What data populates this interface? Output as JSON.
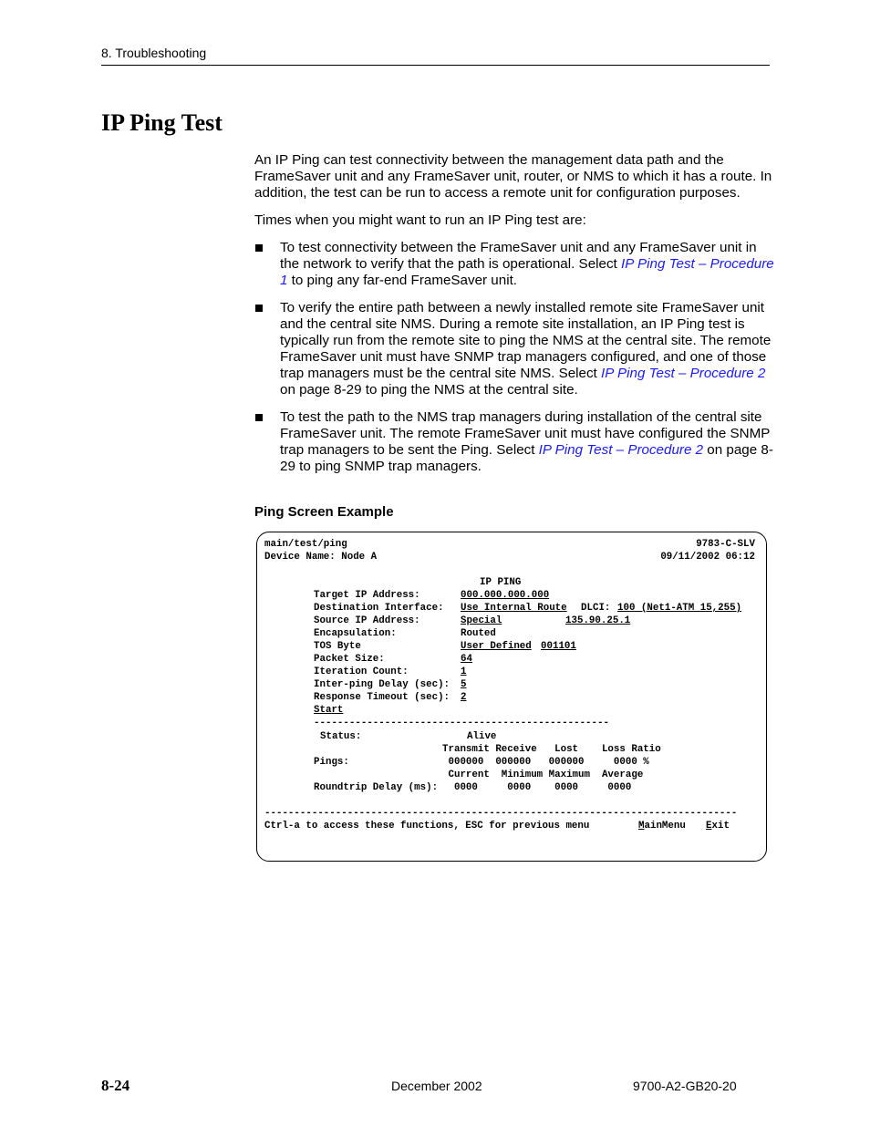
{
  "header": {
    "chapter": "8. Troubleshooting"
  },
  "title": "IP Ping Test",
  "intro": "An IP Ping can test connectivity between the management data path and the FrameSaver unit and any FrameSaver unit, router, or NMS to which it has a route. In addition, the test can be run to access a remote unit for configuration purposes.",
  "lead_in": "Times when you might want to run an IP Ping test are:",
  "bullets": [
    {
      "pre": "To test connectivity between the FrameSaver unit and any FrameSaver unit in the network to verify that the path is operational. Select ",
      "link": "IP Ping Test – Procedure 1",
      "post": " to ping any far-end FrameSaver unit."
    },
    {
      "pre": "To verify the entire path between a newly installed remote site FrameSaver unit and the central site NMS. During a remote site installation, an IP Ping test is typically run from the remote site to ping the NMS at the central site. The remote FrameSaver unit must have SNMP trap managers configured, and one of those trap managers must be the central site NMS. Select ",
      "link": "IP Ping Test – Procedure 2",
      "post": " on page 8-29 to ping the NMS at the central site."
    },
    {
      "pre": "To test the path to the NMS trap managers during installation of the central site FrameSaver unit. The remote FrameSaver unit must have configured the SNMP trap managers to be sent the Ping. Select ",
      "link": "IP Ping Test – Procedure 2",
      "post": " on page 8-29 to ping SNMP trap managers."
    }
  ],
  "example_heading": "Ping Screen Example",
  "screen": {
    "path": "main/test/ping",
    "model": "9783-C-SLV",
    "device_name": "Device Name: Node A",
    "datetime": "09/11/2002 06:12",
    "screen_title": "IP PING",
    "fields": {
      "target_ip_label": "Target IP Address:",
      "target_ip_value": "000.000.000.000",
      "dest_if_label": "Destination Interface:",
      "dest_if_value": "Use Internal Route",
      "dlci_label": "DLCI:",
      "dlci_value": "100 (Net1-ATM 15,255)",
      "source_ip_label": "Source IP Address:",
      "source_ip_value": "Special",
      "source_ip_addr": "135.90.25.1",
      "encap_label": "Encapsulation:",
      "encap_value": "Routed",
      "tos_label": "TOS Byte",
      "tos_value": "User Defined",
      "tos_bits": "001101",
      "packet_label": "Packet Size:",
      "packet_value": "64",
      "iter_label": "Iteration Count:",
      "iter_value": "1",
      "delay_label": "Inter-ping Delay (sec):",
      "delay_value": "5",
      "timeout_label": "Response Timeout (sec):",
      "timeout_value": "2",
      "start": "Start"
    },
    "separator_short": "--------------------------------------------------",
    "status_label": "Status:",
    "status_value": "Alive",
    "pings_header": "Transmit Receive   Lost    Loss Ratio",
    "pings_label": "Pings:",
    "pings_values": " 000000  000000   000000     0000 %",
    "delay_header": " Current  Minimum Maximum  Average",
    "rt_label": "Roundtrip Delay (ms):",
    "rt_values": "  0000     0000    0000     0000",
    "separator_long": "--------------------------------------------------------------------------------",
    "help_text": "Ctrl-a to access these functions, ESC for previous menu",
    "menu": {
      "mainmenu_hot": "M",
      "mainmenu_rest": "ainMenu",
      "exit_hot": "E",
      "exit_rest": "xit"
    }
  },
  "footer": {
    "page": "8-24",
    "date": "December 2002",
    "doc_number": "9700-A2-GB20-20"
  }
}
